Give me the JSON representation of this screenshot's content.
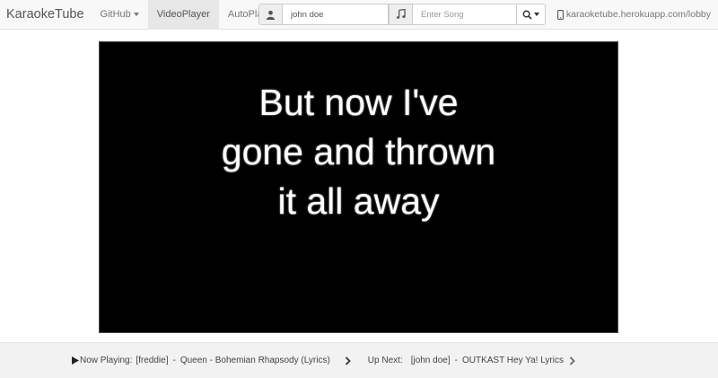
{
  "navbar": {
    "brand": "KaraokeTube",
    "items": [
      {
        "label": "GitHub",
        "dropdown": true,
        "active": false
      },
      {
        "label": "VideoPlayer",
        "dropdown": false,
        "active": true
      },
      {
        "label": "AutoPlay",
        "dropdown": false,
        "active": false
      }
    ],
    "user_input": {
      "value": "john doe",
      "icon": "user-icon"
    },
    "song_input": {
      "placeholder": "Enter Song",
      "icon": "music-note-icon"
    },
    "search_button": {
      "icon": "search-icon"
    },
    "url": "karaoketube.herokuapp.com/lobby",
    "url_icon": "mobile-phone-icon"
  },
  "player": {
    "lyrics": [
      "But now I've",
      "gone and thrown",
      "it all away"
    ]
  },
  "footer": {
    "now_playing_label": "Now Playing:",
    "now_playing_user": "[freddie]",
    "now_playing_sep": "-",
    "now_playing_title": "Queen - Bohemian Rhapsody (Lyrics)",
    "up_next_label": "Up Next:",
    "up_next_user": "[john doe]",
    "up_next_sep": "-",
    "up_next_title": "OUTKAST Hey Ya! Lyrics"
  },
  "colors": {
    "navbar_bg": "#f8f8f8",
    "active_tab_bg": "#e7e7e7",
    "player_bg": "#000000",
    "lyrics_text": "#ffffff",
    "footer_bg": "#f2f2f2"
  }
}
